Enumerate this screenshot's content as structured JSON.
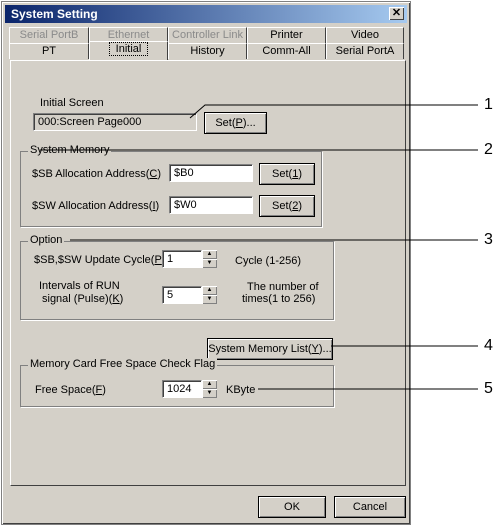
{
  "dialog": {
    "title": "System Setting",
    "close_label": "✕",
    "tabs_row1": [
      "Serial PortB",
      "Ethernet",
      "Controller Link",
      "Printer",
      "Video"
    ],
    "tabs_row2": [
      "PT",
      "Initial",
      "History",
      "Comm-All",
      "Serial PortA"
    ],
    "active_tab": "Initial"
  },
  "initial_screen": {
    "label": "Initial Screen",
    "value": "000:Screen Page000",
    "set_label": "Set(P)..."
  },
  "system_memory": {
    "group_label": "System Memory",
    "sb_label": "$SB Allocation Address(C)",
    "sb_value": "$B0",
    "sb_set": "Set(1)",
    "sw_label": "$SW Allocation Address(I)",
    "sw_value": "$W0",
    "sw_set": "Set(2)"
  },
  "option": {
    "group_label": "Option",
    "update_label": "$SB,$SW Update Cycle(P)",
    "update_value": "1",
    "update_unit": "Cycle (1-256)",
    "run_label_1": "Intervals of RUN",
    "run_label_2": "signal (Pulse)(K)",
    "run_value": "5",
    "run_unit_1": "The number of",
    "run_unit_2": "times(1 to 256)"
  },
  "system_memory_list_label": "System Memory List(Y)...",
  "memory_card": {
    "group_label": "Memory Card Free Space Check Flag",
    "free_label": "Free Space(F)",
    "free_value": "1024",
    "unit": "KByte"
  },
  "footer": {
    "ok": "OK",
    "cancel": "Cancel"
  },
  "callouts": [
    "1",
    "2",
    "3",
    "4",
    "5"
  ]
}
